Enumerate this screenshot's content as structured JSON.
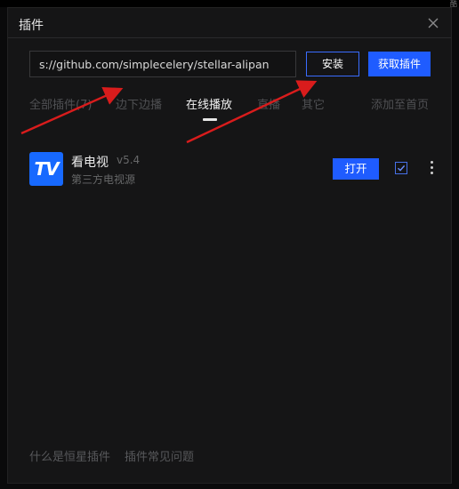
{
  "dialog": {
    "title": "插件"
  },
  "background": {
    "corner_text": "酷"
  },
  "install_bar": {
    "url_value": "s://github.com/simplecelery/stellar-alipan",
    "install_label": "安装",
    "get_plugins_label": "获取插件"
  },
  "tabs": [
    {
      "label": "全部插件(7)",
      "active": false
    },
    {
      "label": "边下边播",
      "active": false
    },
    {
      "label": "在线播放",
      "active": true
    },
    {
      "label": "直播",
      "active": false
    },
    {
      "label": "其它",
      "active": false
    }
  ],
  "add_to_home_label": "添加至首页",
  "plugins": [
    {
      "logo_text": "TV",
      "name": "看电视",
      "version": "v5.4",
      "description": "第三方电视源",
      "open_label": "打开",
      "checked": true
    }
  ],
  "footer": {
    "what_is_label": "什么是恒星插件",
    "faq_label": "插件常见问题"
  },
  "colors": {
    "accent": "#1f5cff",
    "annotation_arrow": "#d91c1c",
    "dialog_bg": "#151516"
  },
  "icons": {
    "close": "close-icon",
    "check": "checkmark-icon",
    "more": "more-vertical-icon"
  }
}
